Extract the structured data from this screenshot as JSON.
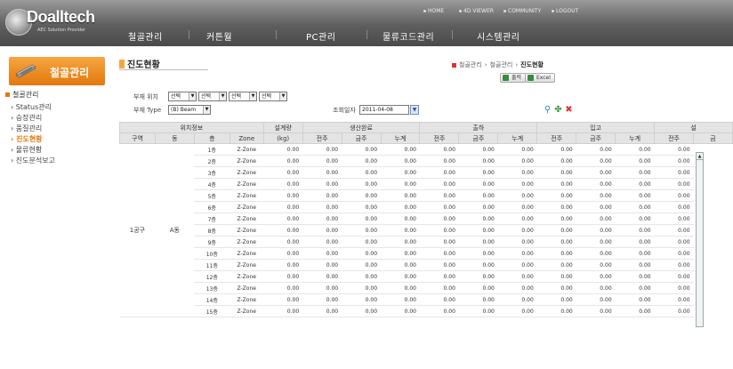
{
  "header": {
    "logo_text": "Doalltech",
    "logo_tagline": "AEC Solution Provider",
    "util_links": [
      "HOME",
      "4D VIEWER",
      "COMMUNITY",
      "LOGOUT"
    ],
    "menu": [
      "철골관리",
      "커튼월",
      "PC관리",
      "물류코드관리",
      "시스템관리"
    ]
  },
  "sidebar": {
    "title": "철골관리",
    "section": "철골관리",
    "items": [
      "Status관리",
      "승장관리",
      "품질관리",
      "진도현황",
      "물류현황",
      "진도분석보고"
    ],
    "active_index": 3
  },
  "page": {
    "title": "진도현황",
    "breadcrumb": [
      "철골관리",
      "철골관리",
      "진도현황"
    ],
    "print_label": "출력",
    "excel_label": "Excel"
  },
  "filters": {
    "location_label": "부재 위치",
    "location_selects": [
      "선택",
      "선택",
      "선택",
      "선택"
    ],
    "type_label": "부재 Type",
    "type_value": "(B) Beam",
    "date_label": "조회일자",
    "date_value": "2011-04-08"
  },
  "table": {
    "group_headers": [
      "위치정보",
      "설계량",
      "생산완료",
      "출하",
      "입고",
      "설"
    ],
    "sub_headers": [
      "구역",
      "동",
      "층",
      "Zone",
      "(kg)",
      "전주",
      "금주",
      "누계",
      "전주",
      "금주",
      "누계",
      "전주",
      "금주",
      "누계",
      "전주",
      "금"
    ],
    "merged_zone": "1공구",
    "merged_dong": "A동",
    "rows": [
      {
        "floor": "1층",
        "zone": "Z-Zone",
        "vals": [
          "0.00",
          "0.00",
          "0.00",
          "0.00",
          "0.00",
          "0.00",
          "0.00",
          "0.00",
          "0.00",
          "0.00",
          "0.00"
        ]
      },
      {
        "floor": "2층",
        "zone": "Z-Zone",
        "vals": [
          "0.00",
          "0.00",
          "0.00",
          "0.00",
          "0.00",
          "0.00",
          "0.00",
          "0.00",
          "0.00",
          "0.00",
          "0.00"
        ]
      },
      {
        "floor": "3층",
        "zone": "Z-Zone",
        "vals": [
          "0.00",
          "0.00",
          "0.00",
          "0.00",
          "0.00",
          "0.00",
          "0.00",
          "0.00",
          "0.00",
          "0.00",
          "0.00"
        ]
      },
      {
        "floor": "4층",
        "zone": "Z-Zone",
        "vals": [
          "0.00",
          "0.00",
          "0.00",
          "0.00",
          "0.00",
          "0.00",
          "0.00",
          "0.00",
          "0.00",
          "0.00",
          "0.00"
        ]
      },
      {
        "floor": "5층",
        "zone": "Z-Zone",
        "vals": [
          "0.00",
          "0.00",
          "0.00",
          "0.00",
          "0.00",
          "0.00",
          "0.00",
          "0.00",
          "0.00",
          "0.00",
          "0.00"
        ]
      },
      {
        "floor": "6층",
        "zone": "Z-Zone",
        "vals": [
          "0.00",
          "0.00",
          "0.00",
          "0.00",
          "0.00",
          "0.00",
          "0.00",
          "0.00",
          "0.00",
          "0.00",
          "0.00"
        ]
      },
      {
        "floor": "7층",
        "zone": "Z-Zone",
        "vals": [
          "0.00",
          "0.00",
          "0.00",
          "0.00",
          "0.00",
          "0.00",
          "0.00",
          "0.00",
          "0.00",
          "0.00",
          "0.00"
        ]
      },
      {
        "floor": "8층",
        "zone": "Z-Zone",
        "vals": [
          "0.00",
          "0.00",
          "0.00",
          "0.00",
          "0.00",
          "0.00",
          "0.00",
          "0.00",
          "0.00",
          "0.00",
          "0.00"
        ]
      },
      {
        "floor": "9층",
        "zone": "Z-Zone",
        "vals": [
          "0.00",
          "0.00",
          "0.00",
          "0.00",
          "0.00",
          "0.00",
          "0.00",
          "0.00",
          "0.00",
          "0.00",
          "0.00"
        ]
      },
      {
        "floor": "10층",
        "zone": "Z-Zone",
        "vals": [
          "0.00",
          "0.00",
          "0.00",
          "0.00",
          "0.00",
          "0.00",
          "0.00",
          "0.00",
          "0.00",
          "0.00",
          "0.00"
        ]
      },
      {
        "floor": "11층",
        "zone": "Z-Zone",
        "vals": [
          "0.00",
          "0.00",
          "0.00",
          "0.00",
          "0.00",
          "0.00",
          "0.00",
          "0.00",
          "0.00",
          "0.00",
          "0.00"
        ]
      },
      {
        "floor": "12층",
        "zone": "Z-Zone",
        "vals": [
          "0.00",
          "0.00",
          "0.00",
          "0.00",
          "0.00",
          "0.00",
          "0.00",
          "0.00",
          "0.00",
          "0.00",
          "0.00"
        ]
      },
      {
        "floor": "13층",
        "zone": "Z-Zone",
        "vals": [
          "0.00",
          "0.00",
          "0.00",
          "0.00",
          "0.00",
          "0.00",
          "0.00",
          "0.00",
          "0.00",
          "0.00",
          "0.00"
        ]
      },
      {
        "floor": "14층",
        "zone": "Z-Zone",
        "vals": [
          "0.00",
          "0.00",
          "0.00",
          "0.00",
          "0.00",
          "0.00",
          "0.00",
          "0.00",
          "0.00",
          "0.00",
          "0.00"
        ]
      },
      {
        "floor": "15층",
        "zone": "Z-Zone",
        "vals": [
          "0.00",
          "0.00",
          "0.00",
          "0.00",
          "0.00",
          "0.00",
          "0.00",
          "0.00",
          "0.00",
          "0.00",
          "0.00"
        ]
      }
    ]
  },
  "colors": {
    "accent": "#e2780d",
    "header_bg": "#5e5e5e",
    "table_header": "#e4e4e4"
  }
}
